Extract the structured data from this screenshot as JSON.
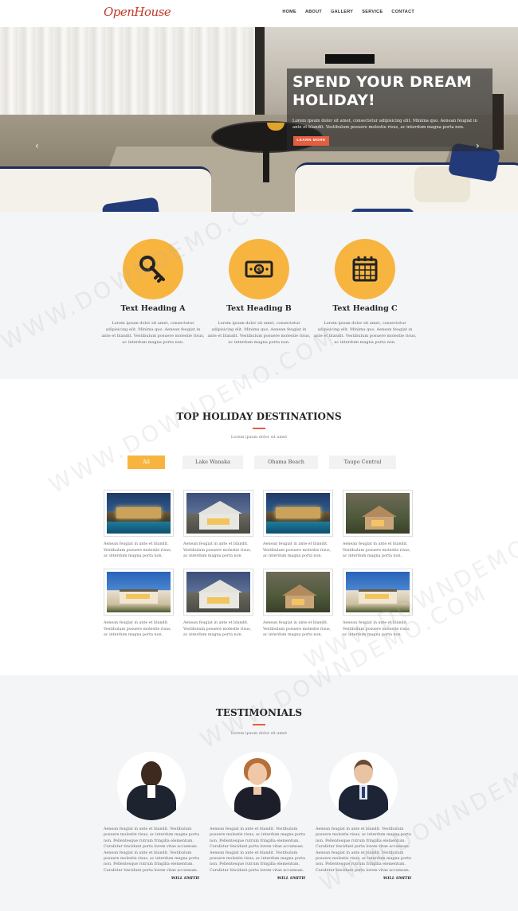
{
  "nav": {
    "logo": "OpenHouse",
    "items": [
      "HOME",
      "ABOUT",
      "GALLERY",
      "SERVICE",
      "CONTACT"
    ]
  },
  "hero": {
    "heading": "SPEND YOUR DREAM HOLIDAY!",
    "text": "Lorem ipsum dolor sit amet, consectetur adipisicing elit. Minima quo. Aenean feugiat in ante et blandit. Vestibulum posuere molestie risus, ac interdum magna porta non.",
    "button": "LEARN MORE",
    "prev_icon": "chevron-left-icon",
    "next_icon": "chevron-right-icon"
  },
  "features": [
    {
      "icon": "key-icon",
      "heading": "Text Heading A",
      "text": "Lorem ipsum dolor sit amet, consectetur adipisicing elit. Minima quo. Aenean feugiat in ante et blandit. Vestibulum posuere molestie risus, ac interdum magna porta non."
    },
    {
      "icon": "money-icon",
      "heading": "Text Heading B",
      "text": "Lorem ipsum dolor sit amet, consectetur adipisicing elit. Minima quo. Aenean feugiat in ante et blandit. Vestibulum posuere molestie risus, ac interdum magna porta non."
    },
    {
      "icon": "calendar-icon",
      "heading": "Text Heading C",
      "text": "Lorem ipsum dolor sit amet, consectetur adipisicing elit. Minima quo. Aenean feugiat in ante et blandit. Vestibulum posuere molestie risus, ac interdum magna porta non."
    }
  ],
  "destinations": {
    "title": "TOP HOLIDAY DESTINATIONS",
    "subtitle": "Lorem ipsum dolor sit amet",
    "filters": [
      "All",
      "Lake Wanaka",
      "Ohama Beach",
      "Taupo Central"
    ],
    "active_filter": "All",
    "card_text": "Aenean feugiat in ante et blandit. Vestibulum posuere molestie risus, ac interdum magna porta non.",
    "cards": [
      {
        "scene": "night-pool"
      },
      {
        "scene": "dusk-house"
      },
      {
        "scene": "night-pool"
      },
      {
        "scene": "forest-house"
      },
      {
        "scene": "palm-villa"
      },
      {
        "scene": "dusk-house"
      },
      {
        "scene": "forest-house"
      },
      {
        "scene": "palm-villa"
      }
    ]
  },
  "testimonials": {
    "title": "TESTIMONIALS",
    "subtitle": "Lorem ipsum dolor sit amet",
    "items": [
      {
        "text": "Aenean feugiat in ante et blandit. Vestibulum posuere molestie risus, ac interdum magna porta non. Pellentesque rutrum fringilla elementum. Curabitur tincidunt porta lorem vitae accumsan. Aenean feugiat in ante et blandit. Vestibulum posuere molestie risus, ac interdum magna porta non. Pellentesque rutrum fringilla elementum. Curabitur tincidunt porta lorem vitae accumsan.",
        "name": "WILL SMITH"
      },
      {
        "text": "Aenean feugiat in ante et blandit. Vestibulum posuere molestie risus, ac interdum magna porta non. Pellentesque rutrum fringilla elementum. Curabitur tincidunt porta lorem vitae accumsan. Aenean feugiat in ante et blandit. Vestibulum posuere molestie risus, ac interdum magna porta non. Pellentesque rutrum fringilla elementum. Curabitur tincidunt porta lorem vitae accumsan.",
        "name": "WILL SMITH"
      },
      {
        "text": "Aenean feugiat in ante et blandit. Vestibulum posuere molestie risus, ac interdum magna porta non. Pellentesque rutrum fringilla elementum. Curabitur tincidunt porta lorem vitae accumsan. Aenean feugiat in ante et blandit. Vestibulum posuere molestie risus, ac interdum magna porta non. Pellentesque rutrum fringilla elementum. Curabitur tincidunt porta lorem vitae accumsan.",
        "name": "WILL SMITH"
      }
    ]
  },
  "watermark": "WWW.DOWNDEMO.COM",
  "colors": {
    "accent": "#f7b540",
    "brand": "#c0392b",
    "button": "#e35e3f"
  }
}
